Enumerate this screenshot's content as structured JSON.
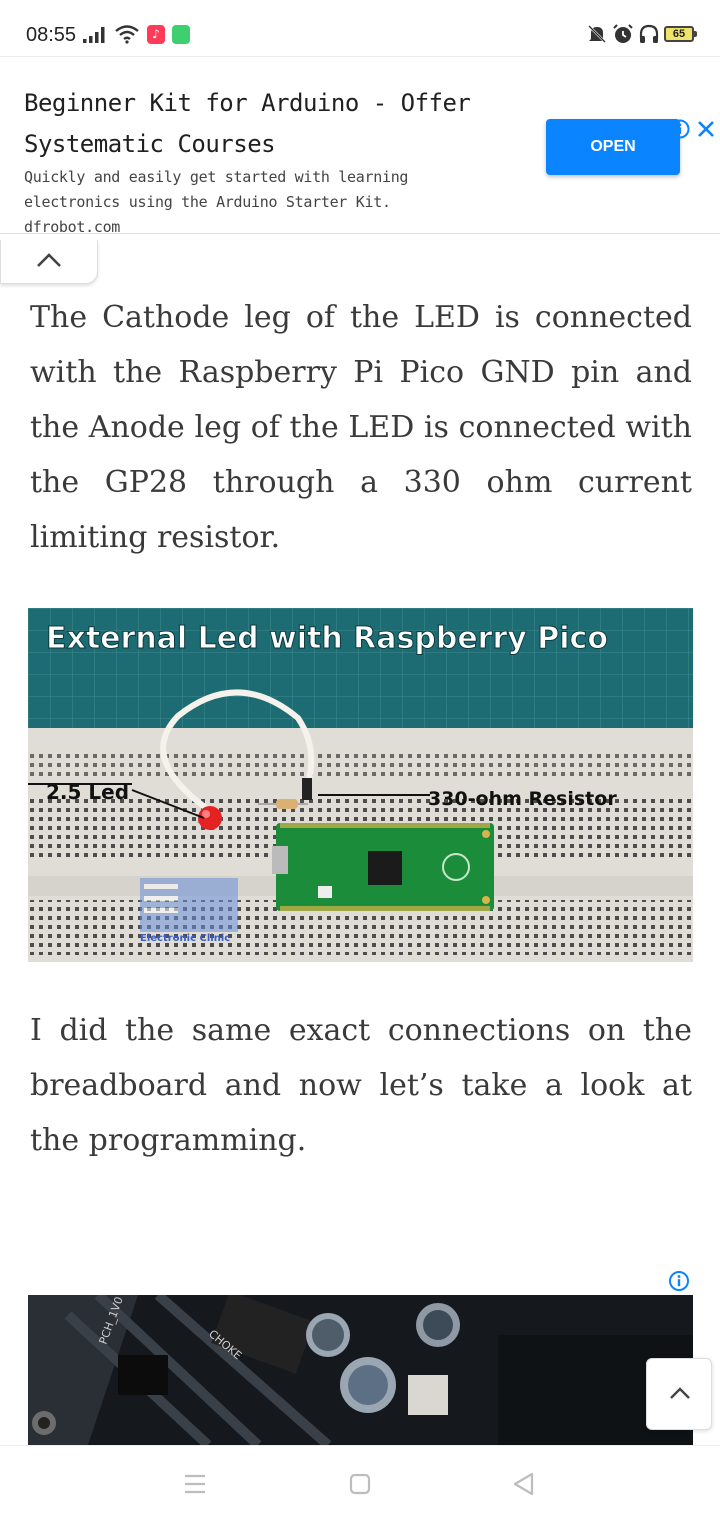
{
  "status_bar": {
    "time": "08:55",
    "battery": "65",
    "app1_glyph": "♪",
    "icons": [
      "signal-icon",
      "wifi-icon",
      "music-app-icon",
      "chat-app-icon",
      "mute-icon",
      "alarm-icon",
      "headphones-icon",
      "battery-icon"
    ]
  },
  "ad_banner": {
    "title": "Beginner Kit for Arduino - Offer Systematic Courses",
    "description": "Quickly and easily get started with learning electronics using the Arduino Starter Kit. dfrobot.com",
    "button_label": "OPEN",
    "accent_color": "#0a84ff"
  },
  "article": {
    "paragraph_1": "The Cathode leg of the LED is connected with the Raspberry Pi Pico GND pin and the Anode leg of the LED is connected with the GP28 through a 330 ohm current limiting resistor.",
    "image": {
      "title": "External Led with Raspberry Pico",
      "label_led": "2.5 Led",
      "label_resistor": "330-ohm Resistor",
      "watermark": "Electronic Clinic"
    },
    "paragraph_2": "I did the same exact connections on the breadboard and now let’s take a look at the programming."
  },
  "ad_image_2": {
    "board_labels": [
      "PCH_1V0",
      "CHOKE"
    ]
  },
  "nav": {
    "buttons": [
      "menu-icon",
      "home-icon",
      "back-icon"
    ]
  }
}
